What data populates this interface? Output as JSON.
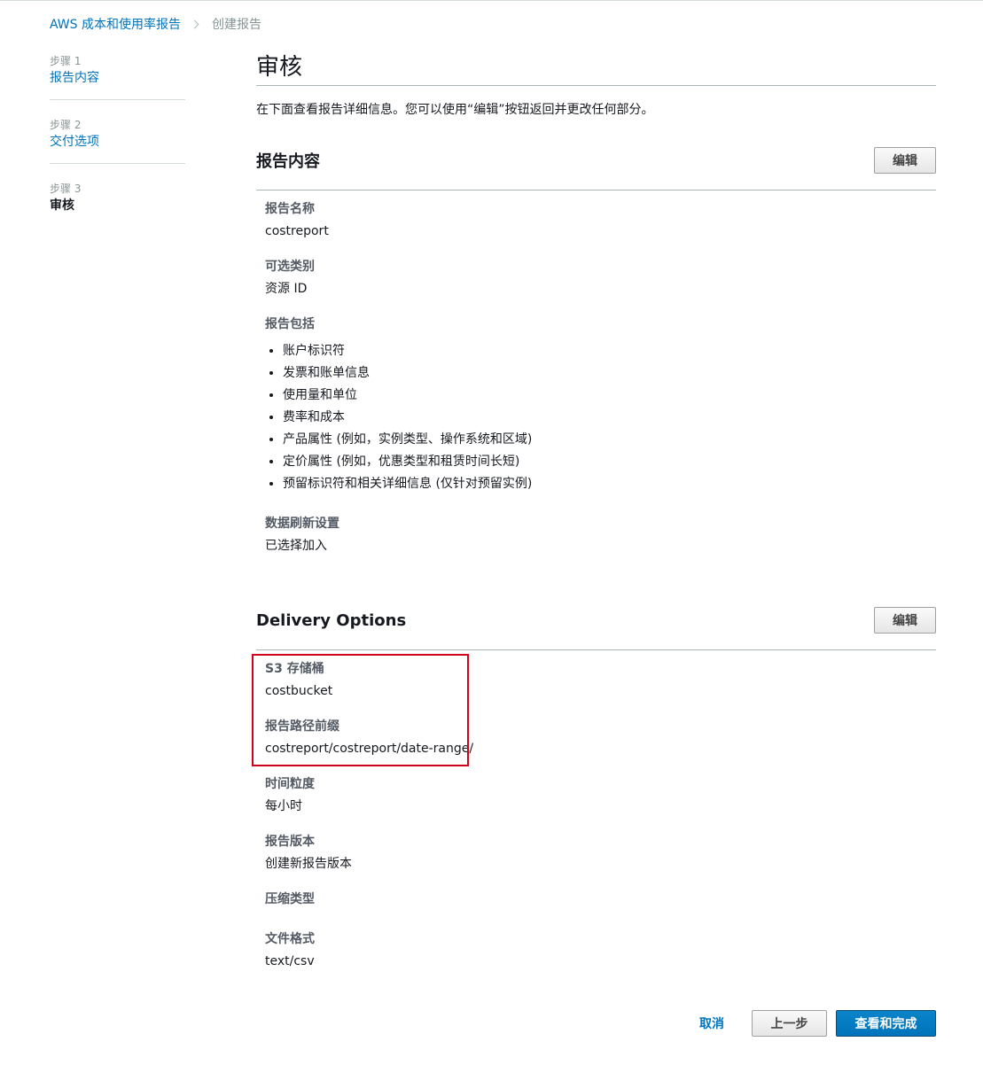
{
  "breadcrumb": {
    "parent": "AWS 成本和使用率报告",
    "current": "创建报告"
  },
  "steps": [
    {
      "num": "步骤 1",
      "label": "报告内容"
    },
    {
      "num": "步骤 2",
      "label": "交付选项"
    },
    {
      "num": "步骤 3",
      "label": "审核"
    }
  ],
  "page": {
    "title": "审核",
    "intro": "在下面查看报告详细信息。您可以使用“编辑”按钮返回并更改任何部分。"
  },
  "report_content": {
    "title": "报告内容",
    "edit_label": "编辑",
    "report_name_label": "报告名称",
    "report_name": "costreport",
    "optional_category_label": "可选类别",
    "optional_category": "资源 ID",
    "includes_label": "报告包括",
    "includes": [
      "账户标识符",
      "发票和账单信息",
      "使用量和单位",
      "费率和成本",
      "产品属性 (例如，实例类型、操作系统和区域)",
      "定价属性 (例如，优惠类型和租赁时间长短)",
      "预留标识符和相关详细信息 (仅针对预留实例)"
    ],
    "refresh_label": "数据刷新设置",
    "refresh_value": "已选择加入"
  },
  "delivery": {
    "title": "Delivery Options",
    "edit_label": "编辑",
    "s3_label": "S3 存储桶",
    "s3_value": "costbucket",
    "prefix_label": "报告路径前缀",
    "prefix_value": "costreport/costreport/date-range/",
    "granularity_label": "时间粒度",
    "granularity_value": "每小时",
    "version_label": "报告版本",
    "version_value": "创建新报告版本",
    "compression_label": "压缩类型",
    "compression_value": "",
    "format_label": "文件格式",
    "format_value": "text/csv"
  },
  "footer": {
    "cancel_label": "取消",
    "prev_label": "上一步",
    "finish_label": "查看和完成"
  },
  "colors": {
    "link": "#0073bb",
    "highlight_border": "#d0021b",
    "primary_button": "#0073bb"
  }
}
